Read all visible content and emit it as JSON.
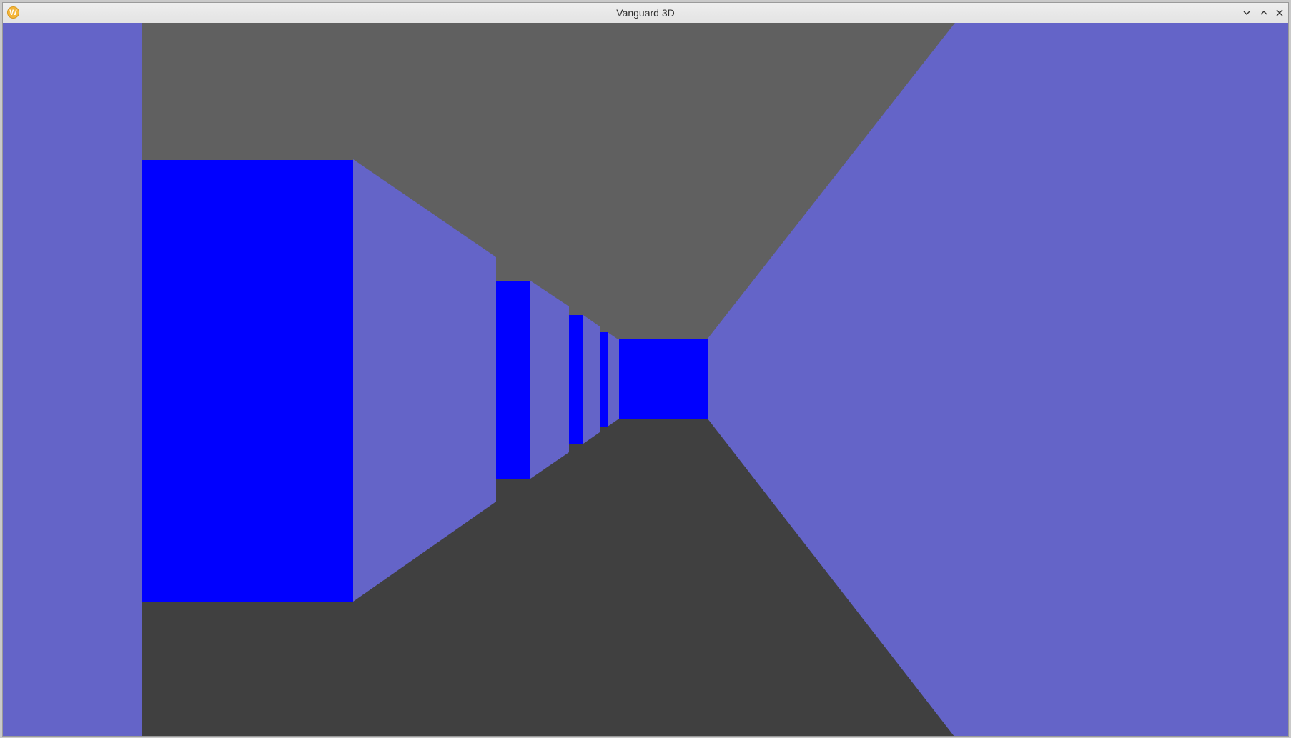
{
  "window": {
    "title": "Vanguard 3D",
    "app_icon_glyph": "W",
    "controls": [
      "minimize-icon",
      "maximize-icon",
      "close-icon"
    ]
  },
  "scene": {
    "type": "first-person corridor",
    "colors": {
      "side_wall": "#6464c8",
      "facing_wall": "#0000ff",
      "ceiling": "#606060",
      "floor": "#404040"
    }
  }
}
